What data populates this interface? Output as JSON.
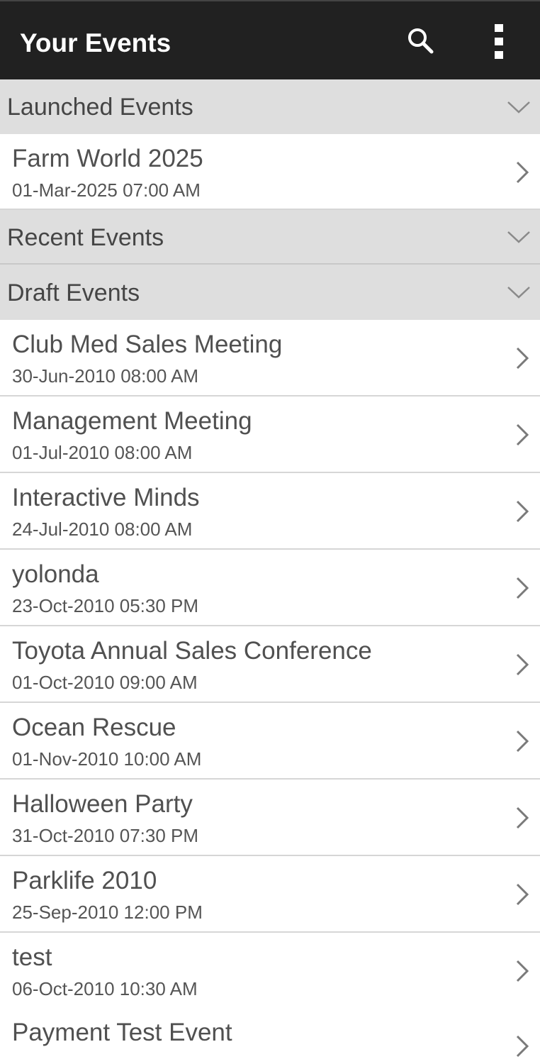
{
  "appbar": {
    "title": "Your Events",
    "search_icon": "search-icon",
    "more_icon": "more-vert-icon"
  },
  "sections": {
    "launched": {
      "label": "Launched Events",
      "icon": "chevron-down-icon"
    },
    "recent": {
      "label": "Recent Events",
      "icon": "chevron-down-icon"
    },
    "draft": {
      "label": "Draft Events",
      "icon": "chevron-down-icon"
    }
  },
  "launched_events": [
    {
      "name": "Farm World 2025",
      "date": "01-Mar-2025 07:00 AM"
    }
  ],
  "draft_events": [
    {
      "name": "Club Med Sales Meeting",
      "date": "30-Jun-2010 08:00 AM"
    },
    {
      "name": "Management Meeting",
      "date": "01-Jul-2010 08:00 AM"
    },
    {
      "name": "Interactive Minds",
      "date": "24-Jul-2010 08:00 AM"
    },
    {
      "name": "yolonda",
      "date": "23-Oct-2010 05:30 PM"
    },
    {
      "name": "Toyota Annual Sales Conference",
      "date": "01-Oct-2010 09:00 AM"
    },
    {
      "name": "Ocean Rescue",
      "date": "01-Nov-2010 10:00 AM"
    },
    {
      "name": "Halloween Party",
      "date": "31-Oct-2010 07:30 PM"
    },
    {
      "name": "Parklife 2010",
      "date": "25-Sep-2010 12:00 PM"
    },
    {
      "name": "test",
      "date": "06-Oct-2010 10:30 AM"
    },
    {
      "name": "Payment Test Event",
      "date": ""
    }
  ],
  "colors": {
    "appbar": "#212121",
    "section_bg": "#dedede",
    "divider": "#d6d6d6"
  }
}
